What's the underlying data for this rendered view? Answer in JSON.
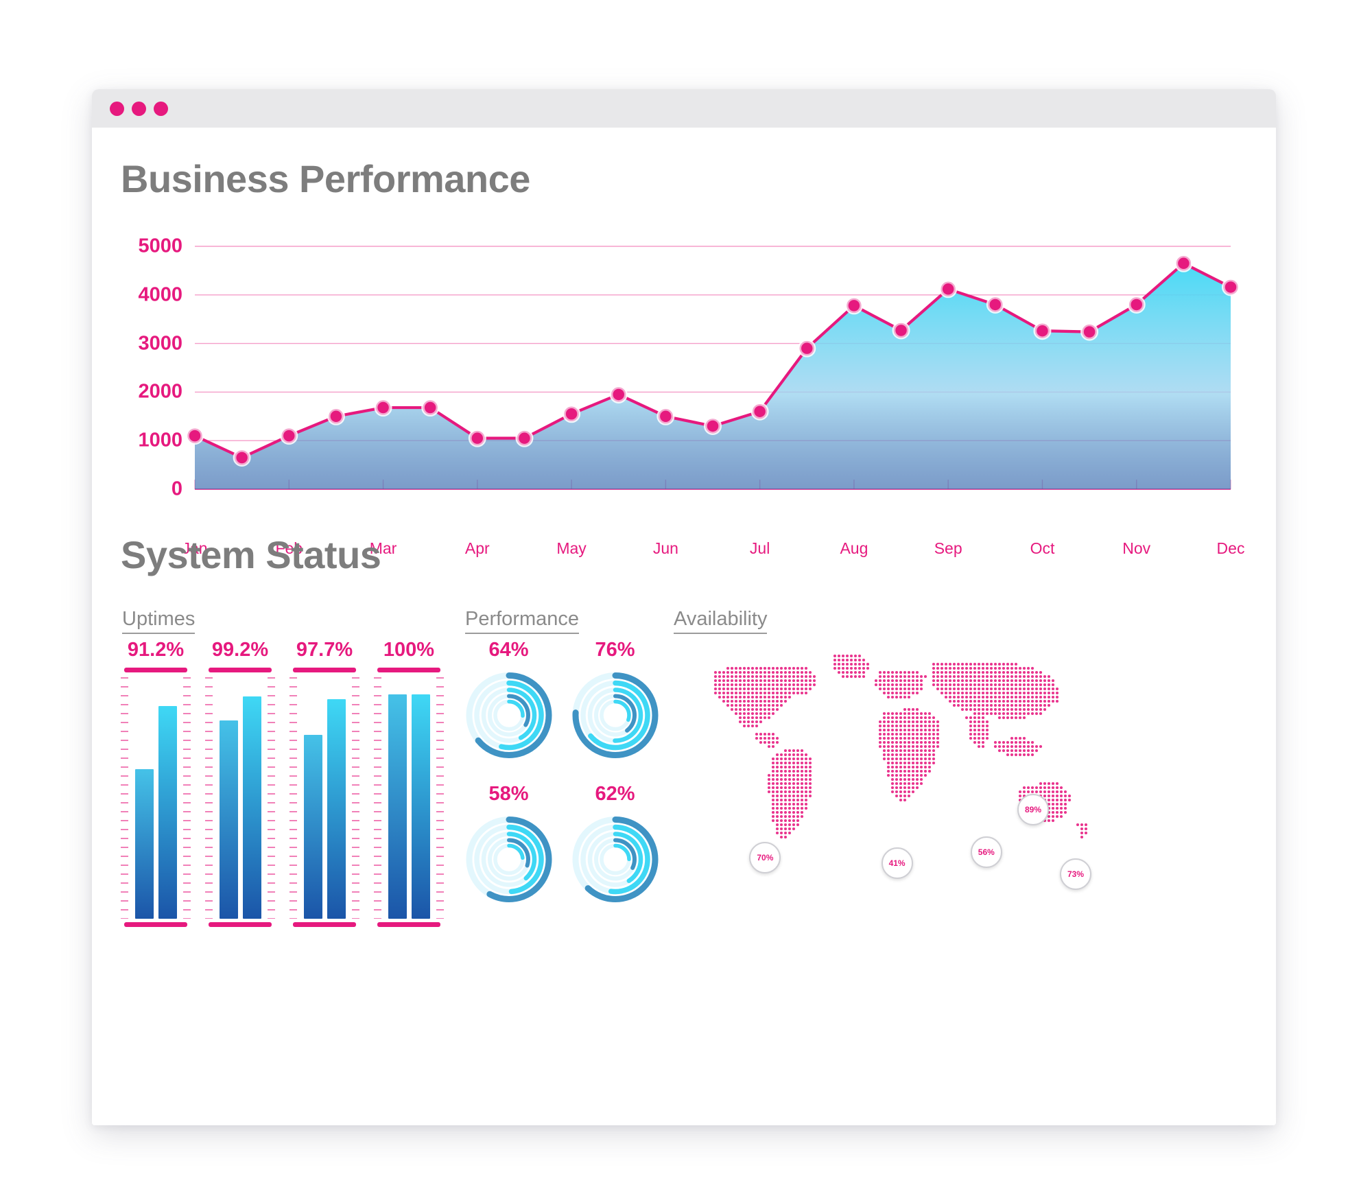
{
  "window": {
    "dots": [
      "close-dot",
      "minimize-dot",
      "maximize-dot"
    ]
  },
  "headings": {
    "business": "Business Performance",
    "system": "System Status"
  },
  "sections": {
    "uptimes": "Uptimes",
    "performance": "Performance",
    "availability": "Availability"
  },
  "colors": {
    "accent_pink": "#e6197e",
    "heading_gray": "#7d7d7d",
    "area_top": "#3fd8f5",
    "area_bottom": "#2b5fa8",
    "bar_top": "#3fd8f5",
    "bar_bottom": "#1b55a8",
    "donut_light": "#3fd8f5",
    "donut_dark": "#3f93c4",
    "titlebar": "#e8e8ea"
  },
  "chart_data": {
    "type": "area",
    "title": "Business Performance",
    "xlabel": "",
    "ylabel": "",
    "ylim": [
      0,
      5000
    ],
    "yticks": [
      0,
      1000,
      2000,
      3000,
      4000,
      5000
    ],
    "ytick_labels": [
      "0",
      "1000",
      "2000",
      "3000",
      "4000",
      "5000"
    ],
    "categories": [
      "Jan",
      "Feb",
      "Mar",
      "Apr",
      "May",
      "Jun",
      "Jul",
      "Aug",
      "Sep",
      "Oct",
      "Nov",
      "Dec"
    ],
    "x": [
      "Jan",
      "Jan-Feb",
      "Feb",
      "Feb-Mar",
      "Mar",
      "Mar-Apr",
      "Apr",
      "Apr-May",
      "May",
      "May-Jun",
      "Jun",
      "Jun-Jul",
      "Jul",
      "Jul-Aug",
      "Aug",
      "Aug-Sep",
      "Sep",
      "Sep-Oct",
      "Oct",
      "Oct-Nov",
      "Nov",
      "Nov-Dec",
      "Dec"
    ],
    "values": [
      1100,
      650,
      1100,
      1500,
      1680,
      1680,
      1050,
      1050,
      1550,
      1950,
      1500,
      1300,
      1600,
      2900,
      3780,
      3270,
      4120,
      3800,
      3260,
      3240,
      3800,
      4650,
      4160
    ],
    "grid": true,
    "legend": null,
    "line_color": "#e6197e",
    "marker_color": "#e6197e"
  },
  "uptimes": {
    "title": "Uptimes",
    "groups": [
      {
        "label": "91.2%",
        "bars": [
          62,
          88
        ]
      },
      {
        "label": "99.2%",
        "bars": [
          82,
          92
        ]
      },
      {
        "label": "97.7%",
        "bars": [
          76,
          91
        ]
      },
      {
        "label": "100%",
        "bars": [
          93,
          93
        ]
      }
    ]
  },
  "performance": {
    "title": "Performance",
    "donuts": [
      {
        "label": "64%",
        "value": 64
      },
      {
        "label": "76%",
        "value": 76
      },
      {
        "label": "58%",
        "value": 58
      },
      {
        "label": "62%",
        "value": 62
      }
    ]
  },
  "availability": {
    "title": "Availability",
    "markers": [
      {
        "label": "70%",
        "x": 22,
        "y": 78
      },
      {
        "label": "41%",
        "x": 53,
        "y": 80
      },
      {
        "label": "56%",
        "x": 74,
        "y": 76
      },
      {
        "label": "89%",
        "x": 85,
        "y": 60
      },
      {
        "label": "73%",
        "x": 95,
        "y": 84
      }
    ]
  }
}
